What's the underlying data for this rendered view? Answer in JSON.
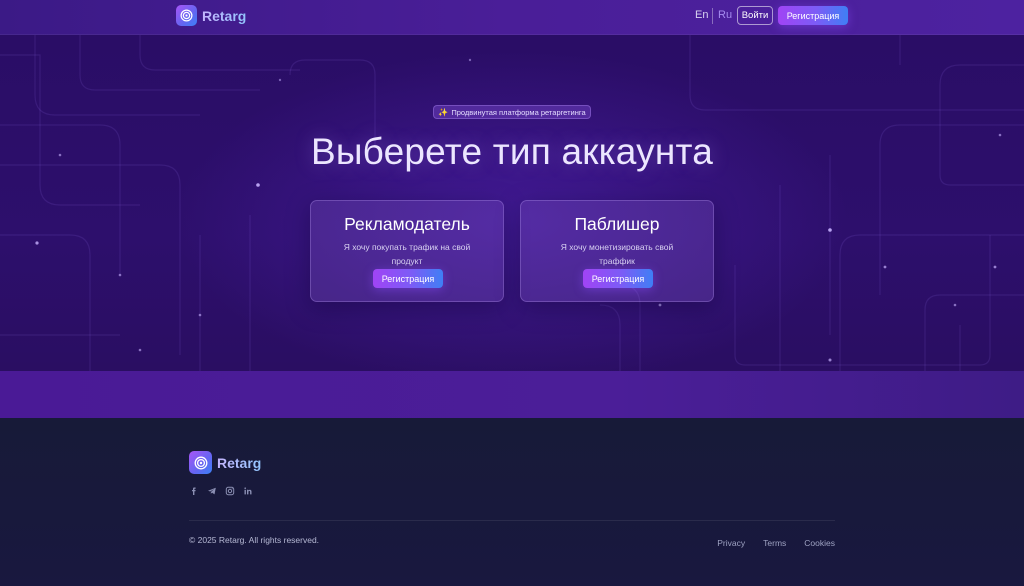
{
  "header": {
    "brand": "Retarg",
    "lang_en": "En",
    "lang_ru": "Ru",
    "login_label": "Войти",
    "register_label": "Регистрация"
  },
  "hero": {
    "badge": "Продвинутая платформа ретаргетинга",
    "badge_icon": "sparkle-icon",
    "title": "Выберете тип аккаунта",
    "cards": [
      {
        "title": "Рекламодатель",
        "description": "Я хочу покупать трафик на свой продукт",
        "button": "Регистрация"
      },
      {
        "title": "Паблишер",
        "description": "Я хочу монетизировать свой траффик",
        "button": "Регистрация"
      }
    ]
  },
  "footer": {
    "brand": "Retarg",
    "socials": [
      "facebook-icon",
      "telegram-icon",
      "instagram-icon",
      "linkedin-icon"
    ],
    "copyright": "© 2025 Retarg. All rights reserved.",
    "links": [
      "Privacy",
      "Terms",
      "Cookies"
    ]
  },
  "colors": {
    "accent_start": "#a044f5",
    "accent_end": "#3f7ff5",
    "hero_bg": "#2a0d66",
    "footer_bg": "#171a38"
  }
}
